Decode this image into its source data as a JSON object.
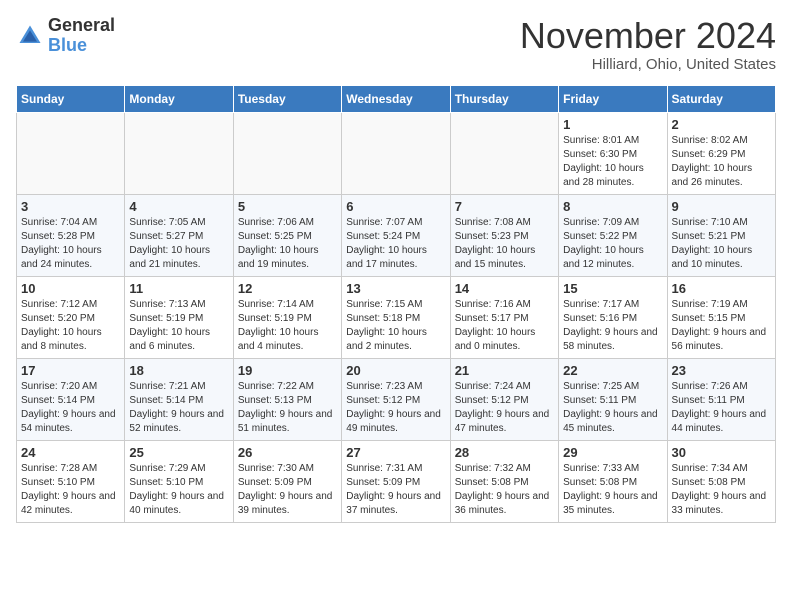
{
  "header": {
    "logo_general": "General",
    "logo_blue": "Blue",
    "month": "November 2024",
    "location": "Hilliard, Ohio, United States"
  },
  "weekdays": [
    "Sunday",
    "Monday",
    "Tuesday",
    "Wednesday",
    "Thursday",
    "Friday",
    "Saturday"
  ],
  "weeks": [
    [
      {
        "day": "",
        "sunrise": "",
        "sunset": "",
        "daylight": ""
      },
      {
        "day": "",
        "sunrise": "",
        "sunset": "",
        "daylight": ""
      },
      {
        "day": "",
        "sunrise": "",
        "sunset": "",
        "daylight": ""
      },
      {
        "day": "",
        "sunrise": "",
        "sunset": "",
        "daylight": ""
      },
      {
        "day": "",
        "sunrise": "",
        "sunset": "",
        "daylight": ""
      },
      {
        "day": "1",
        "sunrise": "Sunrise: 8:01 AM",
        "sunset": "Sunset: 6:30 PM",
        "daylight": "Daylight: 10 hours and 28 minutes."
      },
      {
        "day": "2",
        "sunrise": "Sunrise: 8:02 AM",
        "sunset": "Sunset: 6:29 PM",
        "daylight": "Daylight: 10 hours and 26 minutes."
      }
    ],
    [
      {
        "day": "3",
        "sunrise": "Sunrise: 7:04 AM",
        "sunset": "Sunset: 5:28 PM",
        "daylight": "Daylight: 10 hours and 24 minutes."
      },
      {
        "day": "4",
        "sunrise": "Sunrise: 7:05 AM",
        "sunset": "Sunset: 5:27 PM",
        "daylight": "Daylight: 10 hours and 21 minutes."
      },
      {
        "day": "5",
        "sunrise": "Sunrise: 7:06 AM",
        "sunset": "Sunset: 5:25 PM",
        "daylight": "Daylight: 10 hours and 19 minutes."
      },
      {
        "day": "6",
        "sunrise": "Sunrise: 7:07 AM",
        "sunset": "Sunset: 5:24 PM",
        "daylight": "Daylight: 10 hours and 17 minutes."
      },
      {
        "day": "7",
        "sunrise": "Sunrise: 7:08 AM",
        "sunset": "Sunset: 5:23 PM",
        "daylight": "Daylight: 10 hours and 15 minutes."
      },
      {
        "day": "8",
        "sunrise": "Sunrise: 7:09 AM",
        "sunset": "Sunset: 5:22 PM",
        "daylight": "Daylight: 10 hours and 12 minutes."
      },
      {
        "day": "9",
        "sunrise": "Sunrise: 7:10 AM",
        "sunset": "Sunset: 5:21 PM",
        "daylight": "Daylight: 10 hours and 10 minutes."
      }
    ],
    [
      {
        "day": "10",
        "sunrise": "Sunrise: 7:12 AM",
        "sunset": "Sunset: 5:20 PM",
        "daylight": "Daylight: 10 hours and 8 minutes."
      },
      {
        "day": "11",
        "sunrise": "Sunrise: 7:13 AM",
        "sunset": "Sunset: 5:19 PM",
        "daylight": "Daylight: 10 hours and 6 minutes."
      },
      {
        "day": "12",
        "sunrise": "Sunrise: 7:14 AM",
        "sunset": "Sunset: 5:19 PM",
        "daylight": "Daylight: 10 hours and 4 minutes."
      },
      {
        "day": "13",
        "sunrise": "Sunrise: 7:15 AM",
        "sunset": "Sunset: 5:18 PM",
        "daylight": "Daylight: 10 hours and 2 minutes."
      },
      {
        "day": "14",
        "sunrise": "Sunrise: 7:16 AM",
        "sunset": "Sunset: 5:17 PM",
        "daylight": "Daylight: 10 hours and 0 minutes."
      },
      {
        "day": "15",
        "sunrise": "Sunrise: 7:17 AM",
        "sunset": "Sunset: 5:16 PM",
        "daylight": "Daylight: 9 hours and 58 minutes."
      },
      {
        "day": "16",
        "sunrise": "Sunrise: 7:19 AM",
        "sunset": "Sunset: 5:15 PM",
        "daylight": "Daylight: 9 hours and 56 minutes."
      }
    ],
    [
      {
        "day": "17",
        "sunrise": "Sunrise: 7:20 AM",
        "sunset": "Sunset: 5:14 PM",
        "daylight": "Daylight: 9 hours and 54 minutes."
      },
      {
        "day": "18",
        "sunrise": "Sunrise: 7:21 AM",
        "sunset": "Sunset: 5:14 PM",
        "daylight": "Daylight: 9 hours and 52 minutes."
      },
      {
        "day": "19",
        "sunrise": "Sunrise: 7:22 AM",
        "sunset": "Sunset: 5:13 PM",
        "daylight": "Daylight: 9 hours and 51 minutes."
      },
      {
        "day": "20",
        "sunrise": "Sunrise: 7:23 AM",
        "sunset": "Sunset: 5:12 PM",
        "daylight": "Daylight: 9 hours and 49 minutes."
      },
      {
        "day": "21",
        "sunrise": "Sunrise: 7:24 AM",
        "sunset": "Sunset: 5:12 PM",
        "daylight": "Daylight: 9 hours and 47 minutes."
      },
      {
        "day": "22",
        "sunrise": "Sunrise: 7:25 AM",
        "sunset": "Sunset: 5:11 PM",
        "daylight": "Daylight: 9 hours and 45 minutes."
      },
      {
        "day": "23",
        "sunrise": "Sunrise: 7:26 AM",
        "sunset": "Sunset: 5:11 PM",
        "daylight": "Daylight: 9 hours and 44 minutes."
      }
    ],
    [
      {
        "day": "24",
        "sunrise": "Sunrise: 7:28 AM",
        "sunset": "Sunset: 5:10 PM",
        "daylight": "Daylight: 9 hours and 42 minutes."
      },
      {
        "day": "25",
        "sunrise": "Sunrise: 7:29 AM",
        "sunset": "Sunset: 5:10 PM",
        "daylight": "Daylight: 9 hours and 40 minutes."
      },
      {
        "day": "26",
        "sunrise": "Sunrise: 7:30 AM",
        "sunset": "Sunset: 5:09 PM",
        "daylight": "Daylight: 9 hours and 39 minutes."
      },
      {
        "day": "27",
        "sunrise": "Sunrise: 7:31 AM",
        "sunset": "Sunset: 5:09 PM",
        "daylight": "Daylight: 9 hours and 37 minutes."
      },
      {
        "day": "28",
        "sunrise": "Sunrise: 7:32 AM",
        "sunset": "Sunset: 5:08 PM",
        "daylight": "Daylight: 9 hours and 36 minutes."
      },
      {
        "day": "29",
        "sunrise": "Sunrise: 7:33 AM",
        "sunset": "Sunset: 5:08 PM",
        "daylight": "Daylight: 9 hours and 35 minutes."
      },
      {
        "day": "30",
        "sunrise": "Sunrise: 7:34 AM",
        "sunset": "Sunset: 5:08 PM",
        "daylight": "Daylight: 9 hours and 33 minutes."
      }
    ]
  ]
}
